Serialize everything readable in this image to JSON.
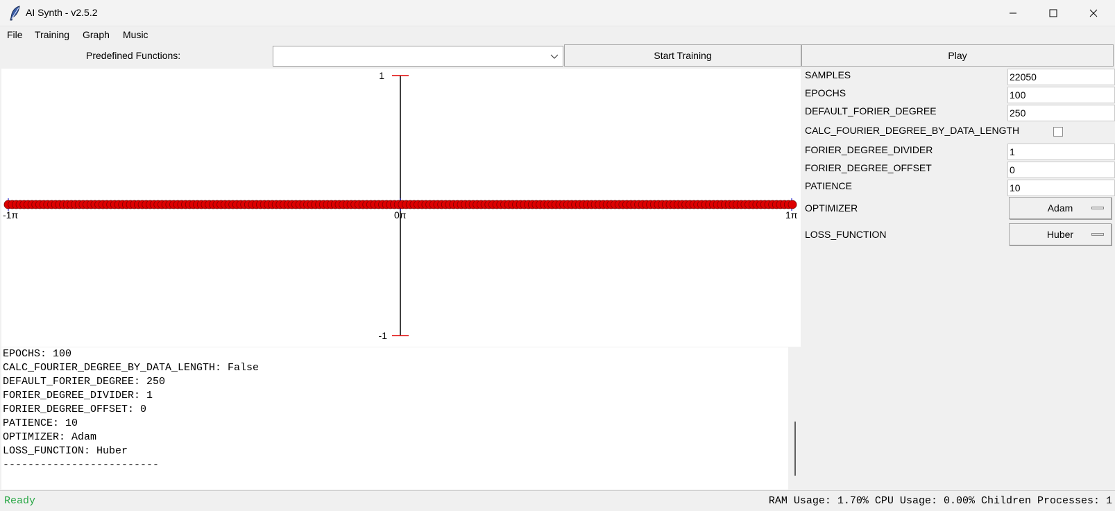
{
  "window": {
    "title": "AI Synth - v2.5.2",
    "app_icon": "feather-icon",
    "controls": [
      "minimize-icon",
      "maximize-icon",
      "close-icon"
    ]
  },
  "menu": [
    "File",
    "Training",
    "Graph",
    "Music"
  ],
  "toolbar": {
    "predefined_label": "Predefined Functions:",
    "predefined_value": "",
    "start_training": "Start Training",
    "play": "Play"
  },
  "graph": {
    "y_max_label": "1",
    "y_min_label": "-1",
    "x_labels": [
      "-1π",
      "0π",
      "1π"
    ],
    "point_count": 200,
    "point_color": "#dd0000",
    "point_outline": "#7a0000",
    "axis_tick_color": "#e00000",
    "x_tick_color": "#0000cc",
    "y_values_all": 0
  },
  "params": {
    "samples_label": "SAMPLES",
    "samples_value": "22050",
    "epochs_label": "EPOCHS",
    "epochs_value": "100",
    "default_degree_label": "DEFAULT_FORIER_DEGREE",
    "default_degree_value": "250",
    "calc_label": "CALC_FOURIER_DEGREE_BY_DATA_LENGTH",
    "calc_checked": false,
    "divider_label": "FORIER_DEGREE_DIVIDER",
    "divider_value": "1",
    "offset_label": "FORIER_DEGREE_OFFSET",
    "offset_value": "0",
    "patience_label": "PATIENCE",
    "patience_value": "10",
    "optimizer_label": "OPTIMIZER",
    "optimizer_value": "Adam",
    "loss_label": "LOSS_FUNCTION",
    "loss_value": "Huber"
  },
  "console": {
    "lines": [
      "EPOCHS: 100",
      "CALC_FOURIER_DEGREE_BY_DATA_LENGTH: False",
      "DEFAULT_FORIER_DEGREE: 250",
      "FORIER_DEGREE_DIVIDER: 1",
      "FORIER_DEGREE_OFFSET: 0",
      "PATIENCE: 10",
      "OPTIMIZER: Adam",
      "LOSS_FUNCTION: Huber",
      "-------------------------"
    ]
  },
  "status": {
    "left": "Ready",
    "left_color": "#28a745",
    "right": "RAM Usage: 1.70% CPU Usage: 0.00% Children Processes: 1"
  }
}
